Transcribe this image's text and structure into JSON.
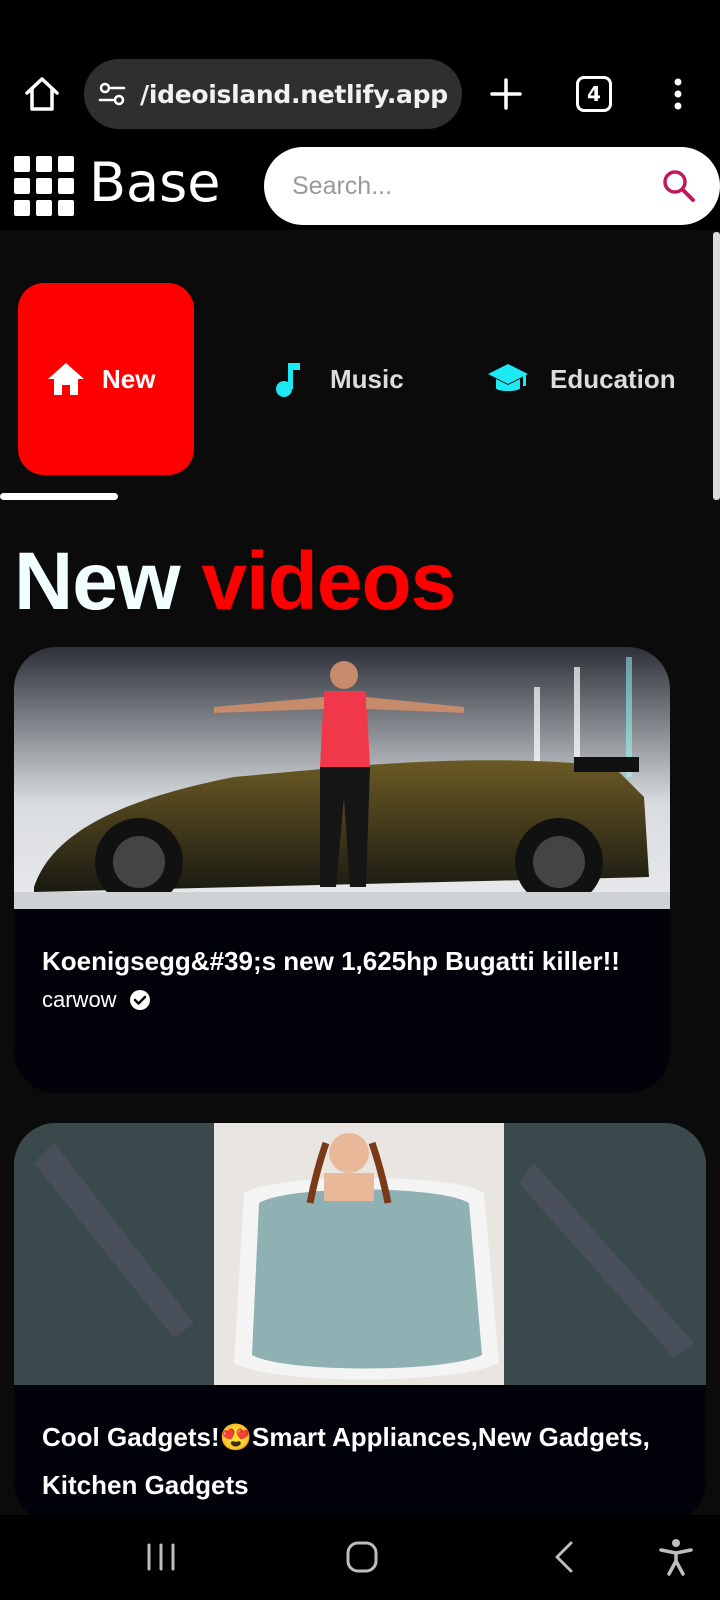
{
  "browser": {
    "url": "/ideoisland.netlify.app",
    "tab_count": "4",
    "icons": {
      "home": "home-icon",
      "site_settings": "site-settings-icon",
      "new_tab": "plus-icon",
      "menu": "more-vertical-icon"
    }
  },
  "header": {
    "brand": "Base",
    "search_placeholder": "Search...",
    "accent_color": "#c2185b"
  },
  "categories": [
    {
      "label": "New",
      "icon": "home-icon",
      "active": true
    },
    {
      "label": "Music",
      "icon": "music-note-icon",
      "active": false
    },
    {
      "label": "Education",
      "icon": "graduation-cap-icon",
      "active": false
    }
  ],
  "section": {
    "title_word1": "New",
    "title_word2": "videos"
  },
  "videos": [
    {
      "title": "Koenigsegg&#39;s new 1,625hp Bugatti killer!!",
      "channel": "carwow",
      "verified": true
    },
    {
      "title": "Cool Gadgets!😍Smart Appliances,New Gadgets, Kitchen Gadgets"
    }
  ],
  "colors": {
    "accent_red": "#ff0000",
    "chip_icon_cyan": "#1de9f5",
    "background": "#0b0b0b"
  }
}
